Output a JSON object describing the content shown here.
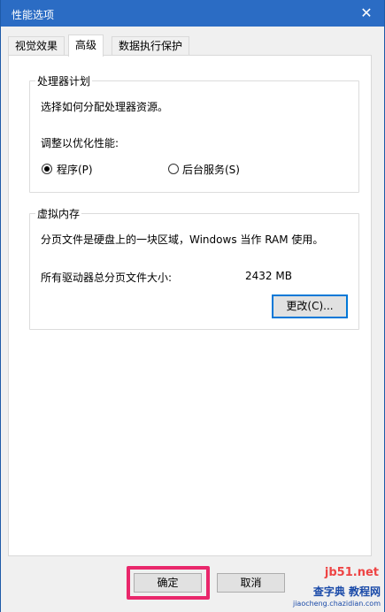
{
  "window": {
    "title": "性能选项",
    "close_glyph": "✕"
  },
  "tabs": [
    {
      "label": "视觉效果",
      "active": false
    },
    {
      "label": "高级",
      "active": true
    },
    {
      "label": "数据执行保护",
      "active": false
    }
  ],
  "processor": {
    "title": "处理器计划",
    "desc": "选择如何分配处理器资源。",
    "adjust_label": "调整以优化性能:",
    "options": [
      {
        "label": "程序(P)",
        "checked": true
      },
      {
        "label": "后台服务(S)",
        "checked": false
      }
    ]
  },
  "virtual_memory": {
    "title": "虚拟内存",
    "desc": "分页文件是硬盘上的一块区域，Windows 当作 RAM 使用。",
    "total_label": "所有驱动器总分页文件大小:",
    "total_value": "2432 MB",
    "change_button": "更改(C)..."
  },
  "footer": {
    "ok": "确定",
    "cancel": "取消"
  },
  "watermark": {
    "top": "jb51.net",
    "mid": "查字典 教程网",
    "bot": "jiaocheng.chazidian.com"
  },
  "colors": {
    "titlebar": "#2b6cc4",
    "highlight": "#e9276b",
    "focus": "#0078d7"
  }
}
